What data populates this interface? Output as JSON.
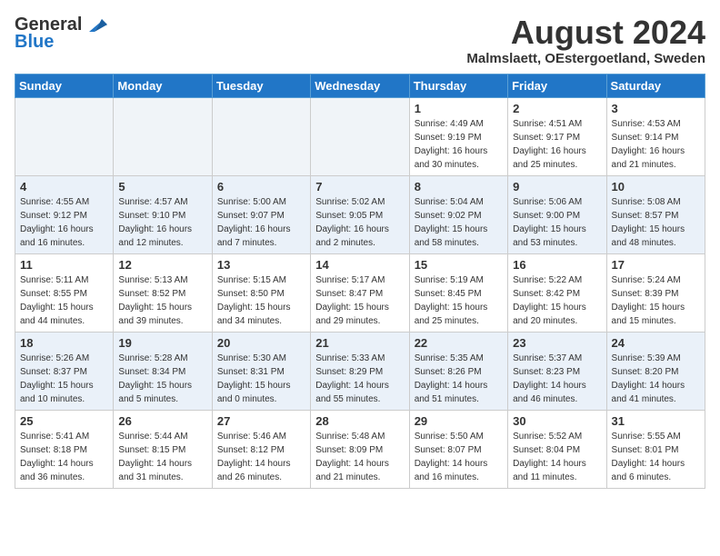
{
  "header": {
    "logo_line1": "General",
    "logo_line2": "Blue",
    "month_year": "August 2024",
    "location": "Malmslaett, OEstergoetland, Sweden"
  },
  "days_of_week": [
    "Sunday",
    "Monday",
    "Tuesday",
    "Wednesday",
    "Thursday",
    "Friday",
    "Saturday"
  ],
  "weeks": [
    [
      {
        "day": "",
        "info": ""
      },
      {
        "day": "",
        "info": ""
      },
      {
        "day": "",
        "info": ""
      },
      {
        "day": "",
        "info": ""
      },
      {
        "day": "1",
        "info": "Sunrise: 4:49 AM\nSunset: 9:19 PM\nDaylight: 16 hours\nand 30 minutes."
      },
      {
        "day": "2",
        "info": "Sunrise: 4:51 AM\nSunset: 9:17 PM\nDaylight: 16 hours\nand 25 minutes."
      },
      {
        "day": "3",
        "info": "Sunrise: 4:53 AM\nSunset: 9:14 PM\nDaylight: 16 hours\nand 21 minutes."
      }
    ],
    [
      {
        "day": "4",
        "info": "Sunrise: 4:55 AM\nSunset: 9:12 PM\nDaylight: 16 hours\nand 16 minutes."
      },
      {
        "day": "5",
        "info": "Sunrise: 4:57 AM\nSunset: 9:10 PM\nDaylight: 16 hours\nand 12 minutes."
      },
      {
        "day": "6",
        "info": "Sunrise: 5:00 AM\nSunset: 9:07 PM\nDaylight: 16 hours\nand 7 minutes."
      },
      {
        "day": "7",
        "info": "Sunrise: 5:02 AM\nSunset: 9:05 PM\nDaylight: 16 hours\nand 2 minutes."
      },
      {
        "day": "8",
        "info": "Sunrise: 5:04 AM\nSunset: 9:02 PM\nDaylight: 15 hours\nand 58 minutes."
      },
      {
        "day": "9",
        "info": "Sunrise: 5:06 AM\nSunset: 9:00 PM\nDaylight: 15 hours\nand 53 minutes."
      },
      {
        "day": "10",
        "info": "Sunrise: 5:08 AM\nSunset: 8:57 PM\nDaylight: 15 hours\nand 48 minutes."
      }
    ],
    [
      {
        "day": "11",
        "info": "Sunrise: 5:11 AM\nSunset: 8:55 PM\nDaylight: 15 hours\nand 44 minutes."
      },
      {
        "day": "12",
        "info": "Sunrise: 5:13 AM\nSunset: 8:52 PM\nDaylight: 15 hours\nand 39 minutes."
      },
      {
        "day": "13",
        "info": "Sunrise: 5:15 AM\nSunset: 8:50 PM\nDaylight: 15 hours\nand 34 minutes."
      },
      {
        "day": "14",
        "info": "Sunrise: 5:17 AM\nSunset: 8:47 PM\nDaylight: 15 hours\nand 29 minutes."
      },
      {
        "day": "15",
        "info": "Sunrise: 5:19 AM\nSunset: 8:45 PM\nDaylight: 15 hours\nand 25 minutes."
      },
      {
        "day": "16",
        "info": "Sunrise: 5:22 AM\nSunset: 8:42 PM\nDaylight: 15 hours\nand 20 minutes."
      },
      {
        "day": "17",
        "info": "Sunrise: 5:24 AM\nSunset: 8:39 PM\nDaylight: 15 hours\nand 15 minutes."
      }
    ],
    [
      {
        "day": "18",
        "info": "Sunrise: 5:26 AM\nSunset: 8:37 PM\nDaylight: 15 hours\nand 10 minutes."
      },
      {
        "day": "19",
        "info": "Sunrise: 5:28 AM\nSunset: 8:34 PM\nDaylight: 15 hours\nand 5 minutes."
      },
      {
        "day": "20",
        "info": "Sunrise: 5:30 AM\nSunset: 8:31 PM\nDaylight: 15 hours\nand 0 minutes."
      },
      {
        "day": "21",
        "info": "Sunrise: 5:33 AM\nSunset: 8:29 PM\nDaylight: 14 hours\nand 55 minutes."
      },
      {
        "day": "22",
        "info": "Sunrise: 5:35 AM\nSunset: 8:26 PM\nDaylight: 14 hours\nand 51 minutes."
      },
      {
        "day": "23",
        "info": "Sunrise: 5:37 AM\nSunset: 8:23 PM\nDaylight: 14 hours\nand 46 minutes."
      },
      {
        "day": "24",
        "info": "Sunrise: 5:39 AM\nSunset: 8:20 PM\nDaylight: 14 hours\nand 41 minutes."
      }
    ],
    [
      {
        "day": "25",
        "info": "Sunrise: 5:41 AM\nSunset: 8:18 PM\nDaylight: 14 hours\nand 36 minutes."
      },
      {
        "day": "26",
        "info": "Sunrise: 5:44 AM\nSunset: 8:15 PM\nDaylight: 14 hours\nand 31 minutes."
      },
      {
        "day": "27",
        "info": "Sunrise: 5:46 AM\nSunset: 8:12 PM\nDaylight: 14 hours\nand 26 minutes."
      },
      {
        "day": "28",
        "info": "Sunrise: 5:48 AM\nSunset: 8:09 PM\nDaylight: 14 hours\nand 21 minutes."
      },
      {
        "day": "29",
        "info": "Sunrise: 5:50 AM\nSunset: 8:07 PM\nDaylight: 14 hours\nand 16 minutes."
      },
      {
        "day": "30",
        "info": "Sunrise: 5:52 AM\nSunset: 8:04 PM\nDaylight: 14 hours\nand 11 minutes."
      },
      {
        "day": "31",
        "info": "Sunrise: 5:55 AM\nSunset: 8:01 PM\nDaylight: 14 hours\nand 6 minutes."
      }
    ]
  ]
}
